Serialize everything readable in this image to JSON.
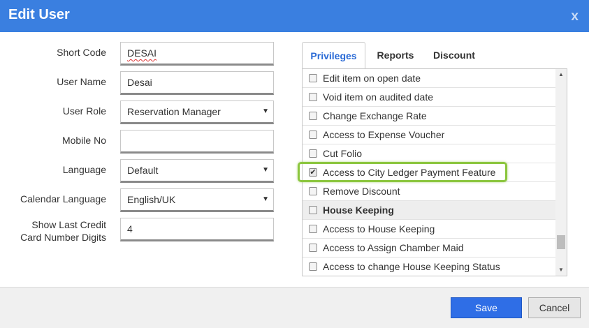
{
  "dialog": {
    "title": "Edit User",
    "close_label": "x"
  },
  "form": {
    "short_code": {
      "label": "Short Code",
      "value": "DESAI"
    },
    "user_name": {
      "label": "User Name",
      "value": "Desai"
    },
    "user_role": {
      "label": "User Role",
      "value": "Reservation Manager"
    },
    "mobile_no": {
      "label": "Mobile No",
      "value": ""
    },
    "language": {
      "label": "Language",
      "value": "Default"
    },
    "calendar_language": {
      "label": "Calendar Language",
      "value": "English/UK"
    },
    "show_last_cc": {
      "label_line1": "Show Last Credit",
      "label_line2": "Card Number Digits",
      "value": "4"
    }
  },
  "tabs": [
    {
      "label": "Privileges",
      "active": true
    },
    {
      "label": "Reports",
      "active": false
    },
    {
      "label": "Discount",
      "active": false
    }
  ],
  "privileges": [
    {
      "label": "Edit item on open date",
      "checked": false
    },
    {
      "label": "Void item on audited date",
      "checked": false
    },
    {
      "label": "Change Exchange Rate",
      "checked": false
    },
    {
      "label": "Access to Expense Voucher",
      "checked": false
    },
    {
      "label": "Cut Folio",
      "checked": false
    },
    {
      "label": "Access to City Ledger Payment Feature",
      "checked": true,
      "highlighted": true
    },
    {
      "label": "Remove Discount",
      "checked": false
    },
    {
      "label": "House Keeping",
      "checked": false,
      "group_header": true
    },
    {
      "label": "Access to House Keeping",
      "checked": false
    },
    {
      "label": "Access to Assign Chamber Maid",
      "checked": false
    },
    {
      "label": "Access to change House Keeping Status",
      "checked": false
    }
  ],
  "icons": {
    "checkmark": "✔",
    "caret": "▼",
    "scroll_up": "▲",
    "scroll_down": "▼"
  },
  "footer": {
    "save_label": "Save",
    "cancel_label": "Cancel"
  },
  "colors": {
    "title_bar": "#3a7fe0",
    "primary_button": "#2f6ee6",
    "highlight": "#8cc63f",
    "active_tab_text": "#2b6bd6"
  }
}
